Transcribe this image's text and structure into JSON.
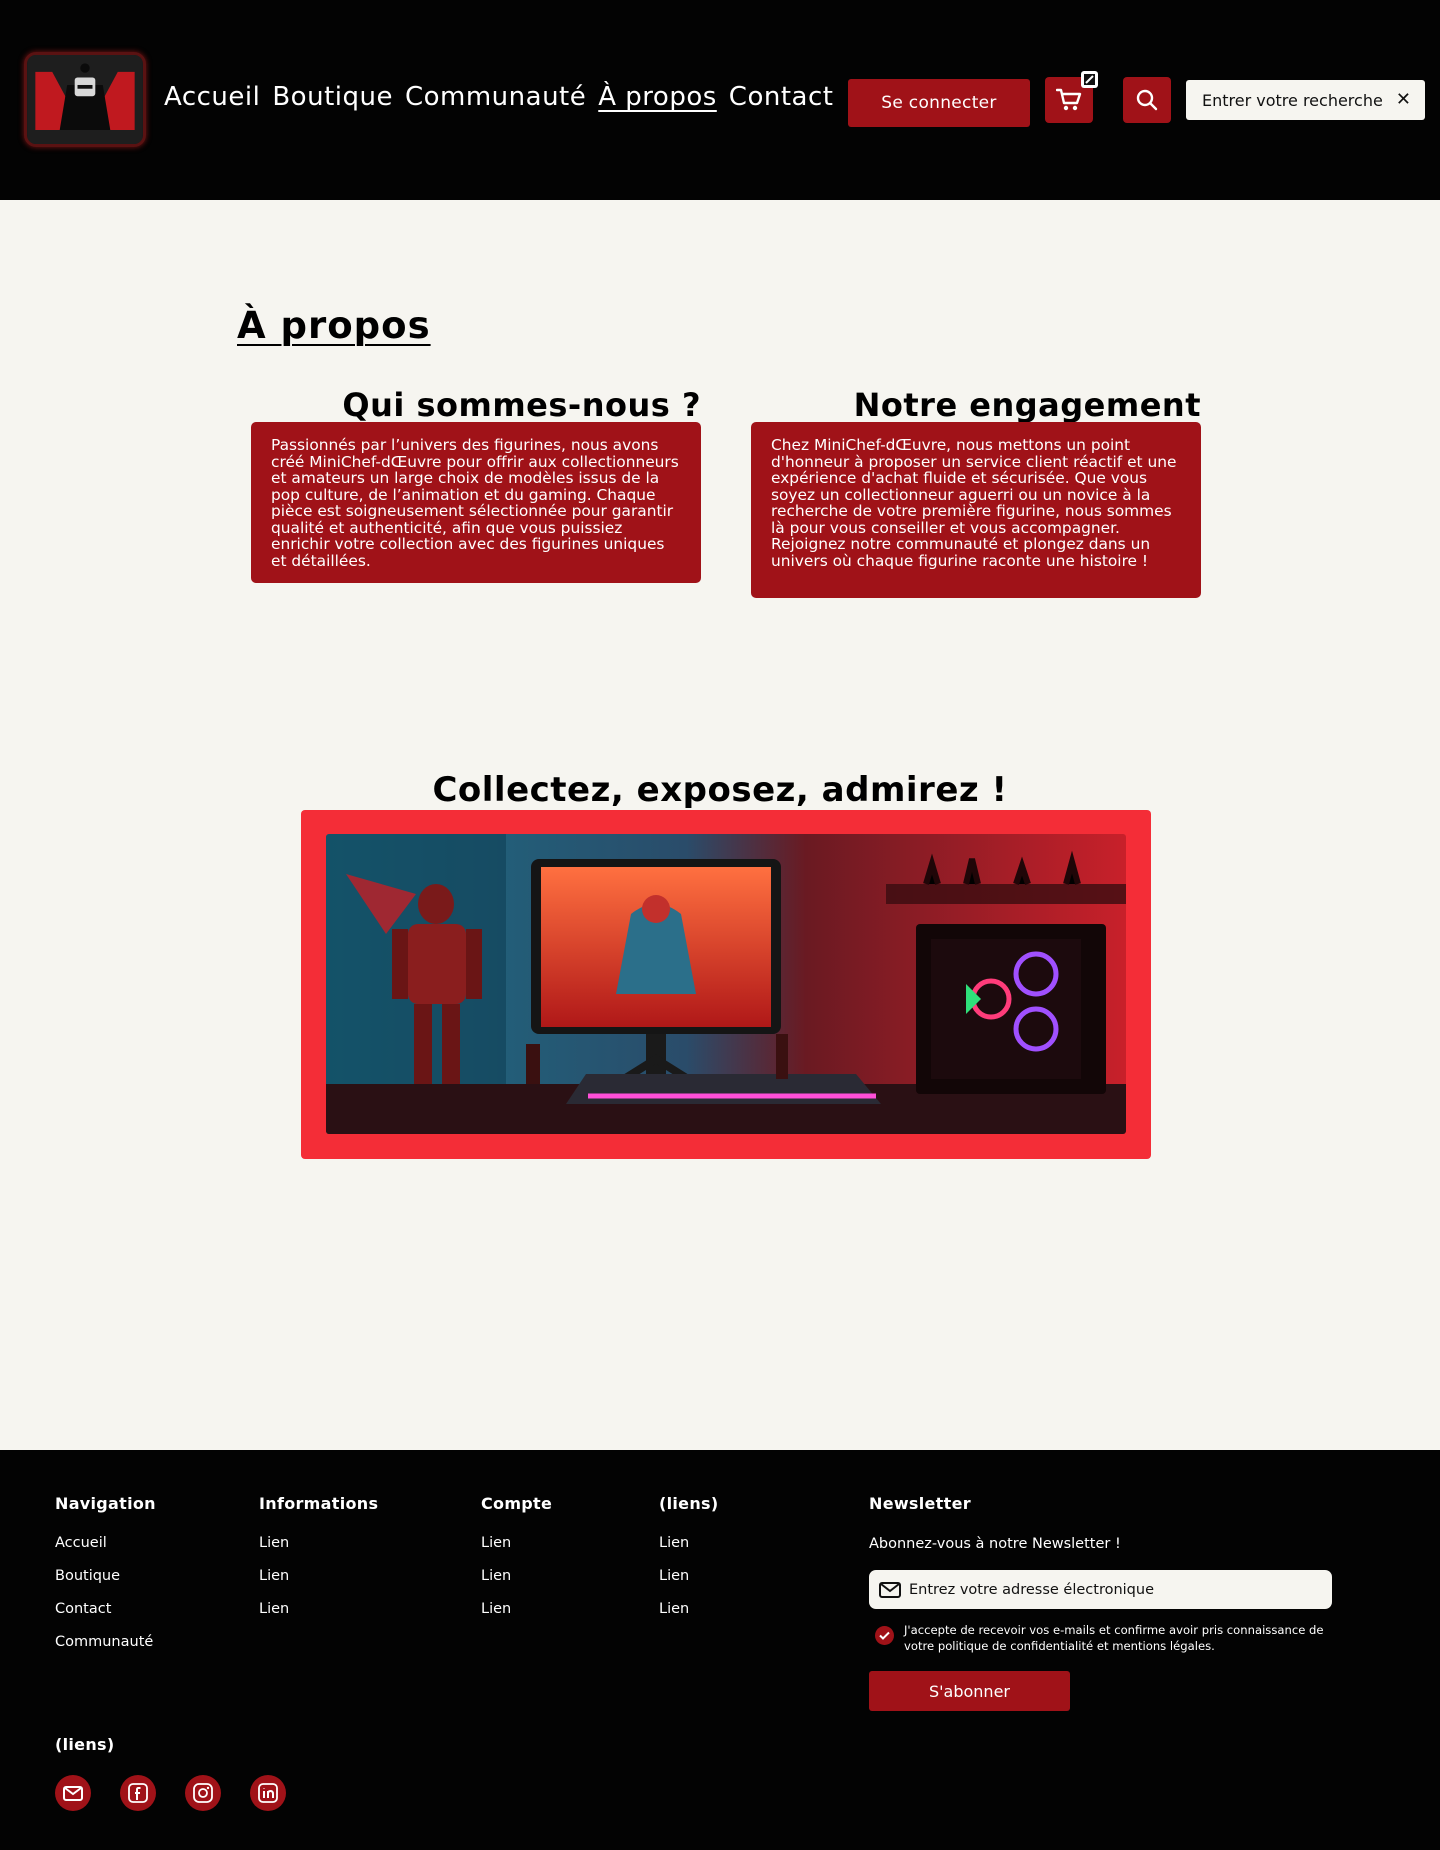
{
  "header": {
    "logo_alt": "MiniChef-dŒuvre",
    "nav": [
      {
        "label": "Accueil",
        "active": false
      },
      {
        "label": "Boutique",
        "active": false
      },
      {
        "label": "Communauté",
        "active": false
      },
      {
        "label": "À propos",
        "active": true
      },
      {
        "label": "Contact",
        "active": false
      }
    ],
    "login_label": "Se connecter",
    "search_placeholder": "Entrer votre recherche",
    "clear_symbol": "✕"
  },
  "main": {
    "title": "À propos",
    "sections": [
      {
        "title": "Qui sommes-nous ?",
        "text": "Passionnés par l’univers des figurines, nous avons créé MiniChef-dŒuvre pour offrir aux collectionneurs et amateurs un large choix de modèles issus de la pop culture, de l’animation et du gaming. Chaque pièce est soigneusement sélectionnée pour garantir qualité et authenticité, afin que vous puissiez enrichir votre collection avec des figurines uniques et détaillées."
      },
      {
        "title": "Notre engagement",
        "text": "Chez MiniChef-dŒuvre, nous mettons un point d'honneur à proposer un service client réactif et une expérience d'achat fluide et sécurisée. Que vous soyez un collectionneur aguerri ou un novice à la recherche de votre première figurine, nous sommes là pour vous conseiller et vous accompagner. Rejoignez notre communauté et plongez dans un univers où chaque figurine raconte une histoire !"
      }
    ],
    "gallery_title": "Collectez, exposez, admirez !"
  },
  "footer": {
    "columns": [
      {
        "heading": "Navigation",
        "links": [
          "Accueil",
          "Boutique",
          "Contact",
          "Communauté"
        ]
      },
      {
        "heading": "Informations",
        "links": [
          "Lien",
          "Lien",
          "Lien"
        ]
      },
      {
        "heading": "Compte",
        "links": [
          "Lien",
          "Lien",
          "Lien"
        ]
      },
      {
        "heading": "(liens)",
        "links": [
          "Lien",
          "Lien",
          "Lien"
        ]
      }
    ],
    "newsletter": {
      "heading": "Newsletter",
      "text": "Abonnez-vous à notre Newsletter !",
      "email_placeholder": "Entrez votre adresse électronique",
      "consent": "J'accepte de recevoir vos e-mails et confirme avoir pris connaissance de votre politique de confidentialité et mentions légales.",
      "consent_checked": true,
      "button": "S'abonner"
    },
    "social_heading": "(liens)",
    "social_icons": [
      "mail-icon",
      "facebook-icon",
      "instagram-icon",
      "linkedin-icon"
    ]
  },
  "colors": {
    "header_bg": "#030303",
    "accent": "#a01218",
    "page_bg": "#f6f5f0",
    "gallery_frame": "#f42d37"
  }
}
